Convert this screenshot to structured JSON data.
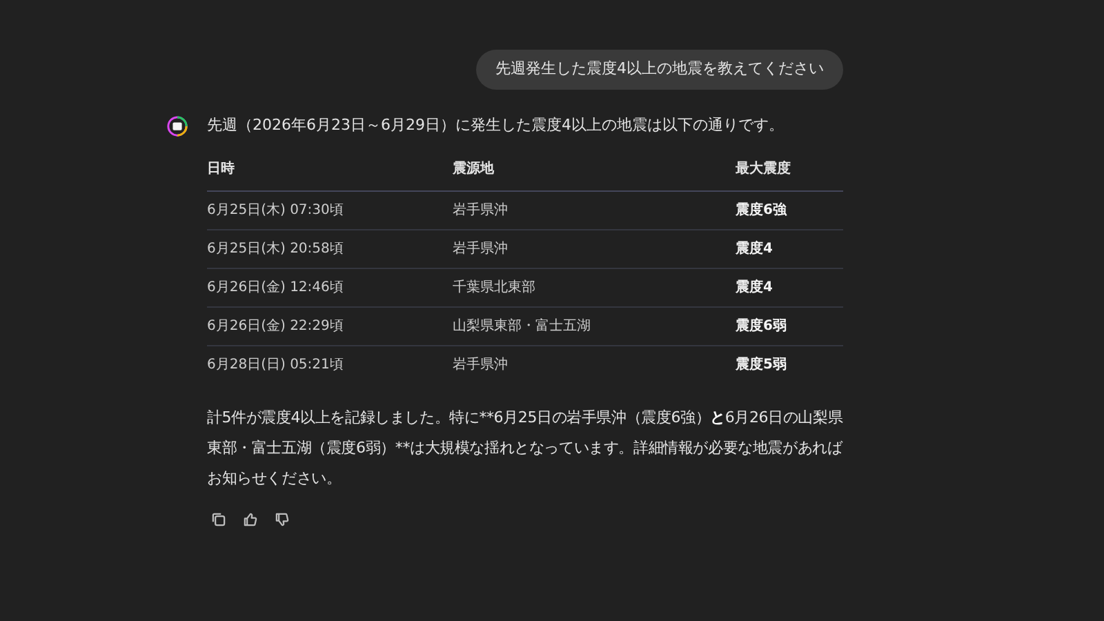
{
  "user_message": "先週発生した震度4以上の地震を教えてください",
  "reply": {
    "intro": "先週（2026年6月23日～6月29日）に発生した震度4以上の地震は以下の通りです。",
    "table": {
      "columns": [
        "日時",
        "震源地",
        "最大震度"
      ],
      "rows": [
        [
          "6月25日(木) 07:30頃",
          "岩手県沖",
          "震度6強"
        ],
        [
          "6月25日(木) 20:58頃",
          "岩手県沖",
          "震度4"
        ],
        [
          "6月26日(金) 12:46頃",
          "千葉県北東部",
          "震度4"
        ],
        [
          "6月26日(金) 22:29頃",
          "山梨県東部・富士五湖",
          "震度6弱"
        ],
        [
          "6月28日(日) 05:21頃",
          "岩手県沖",
          "震度5弱"
        ]
      ]
    },
    "summary": [
      {
        "text": "計5件が震度4以上を記録しました。特に**6月25日の岩手県沖（震度6強）",
        "bold": false
      },
      {
        "text": "と",
        "bold": true
      },
      {
        "text": "6月26日の山梨県東部・富士五湖（震度6弱）**は大規模な揺れとなっています。詳細情報が必要な地震があればお知らせください。",
        "bold": false
      }
    ]
  },
  "actions": [
    {
      "kind": "copy"
    },
    {
      "kind": "like"
    },
    {
      "kind": "dislike"
    }
  ]
}
